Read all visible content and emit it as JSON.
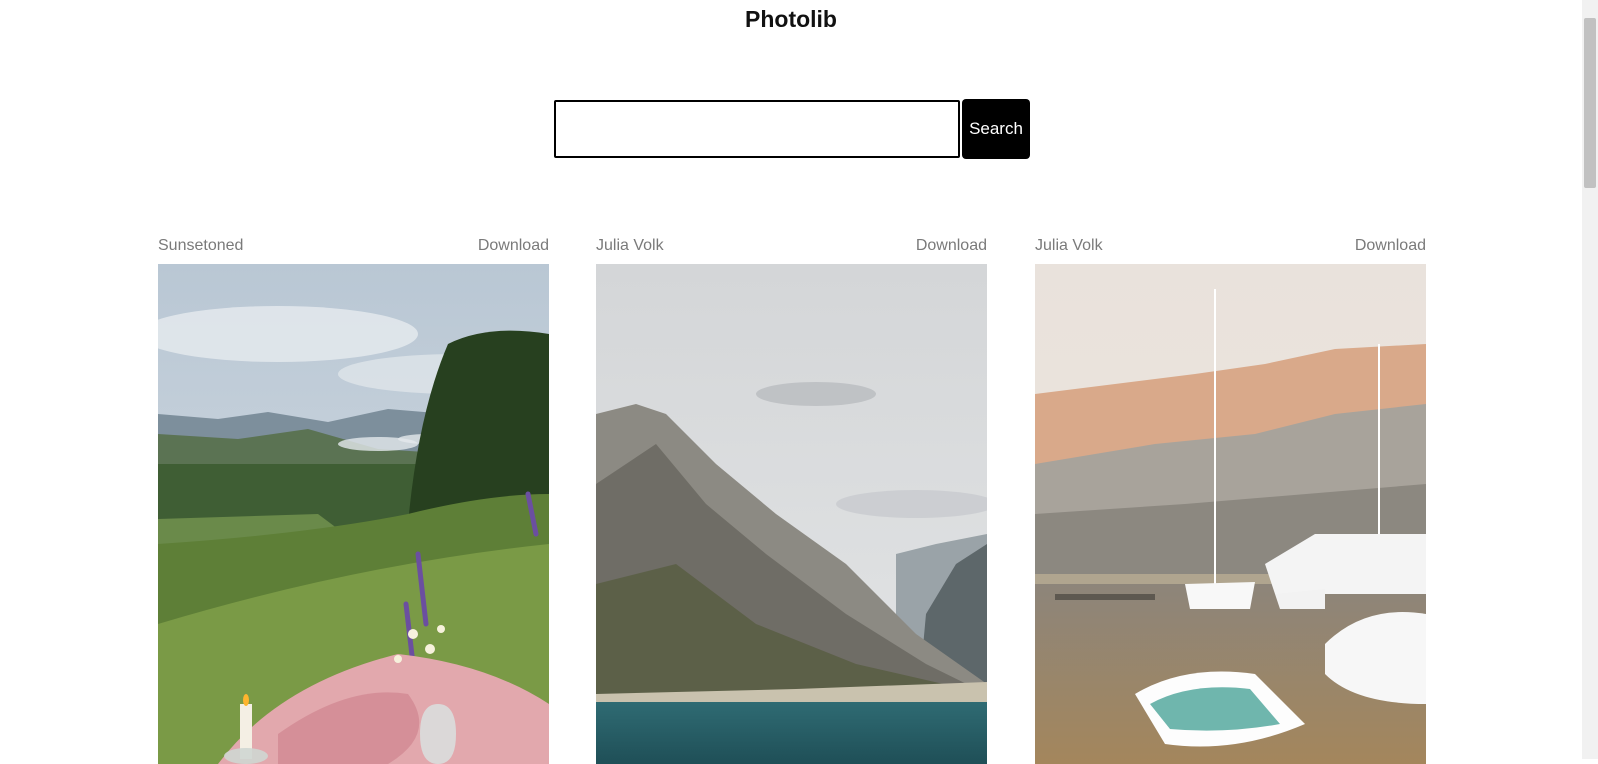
{
  "header": {
    "title": "Photolib"
  },
  "search": {
    "value": "",
    "placeholder": "",
    "button_label": "Search"
  },
  "cards": [
    {
      "author": "Sunsetoned",
      "download_label": "Download",
      "image": "picnic-meadow-mountains-photo"
    },
    {
      "author": "Julia Volk",
      "download_label": "Download",
      "image": "mountain-bay-photo"
    },
    {
      "author": "Julia Volk",
      "download_label": "Download",
      "image": "marina-boats-photo"
    }
  ]
}
